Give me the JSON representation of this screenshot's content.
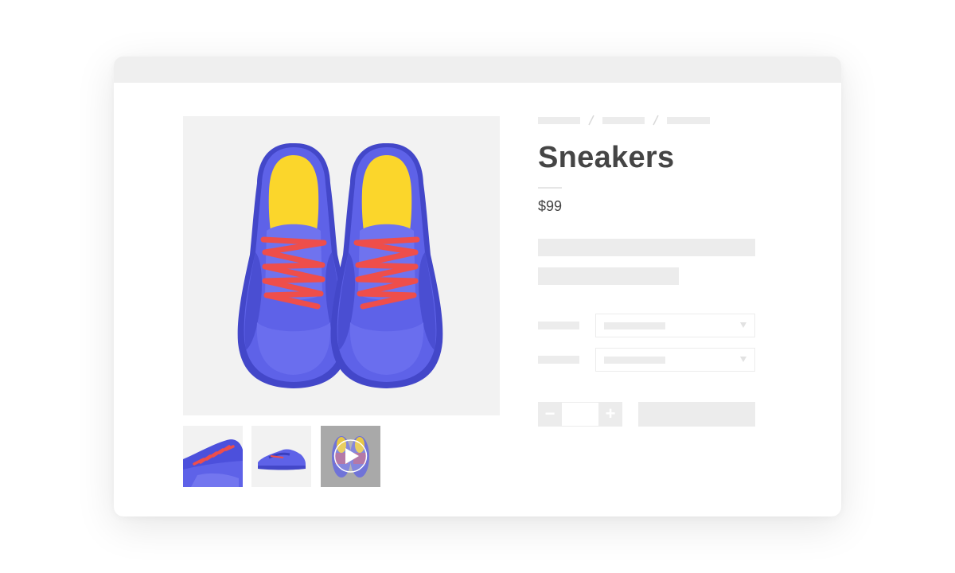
{
  "colors": {
    "accent_blue": "#5e62e8",
    "dark_blue": "#4347c9",
    "insole_yellow": "#fbd62b",
    "lace_red": "#ee4e4b",
    "placeholder_gray": "#ececec",
    "title_text": "#454545"
  },
  "product": {
    "title": "Sneakers",
    "price": "$99"
  },
  "breadcrumb": {
    "separators": [
      "/",
      "/"
    ]
  },
  "quantity": {
    "minus_label": "−",
    "plus_label": "+",
    "value": ""
  },
  "gallery": {
    "thumbnails": [
      {
        "kind": "image",
        "view": "side-angle"
      },
      {
        "kind": "image",
        "view": "side"
      },
      {
        "kind": "video",
        "view": "top",
        "icon": "play-icon"
      }
    ]
  }
}
